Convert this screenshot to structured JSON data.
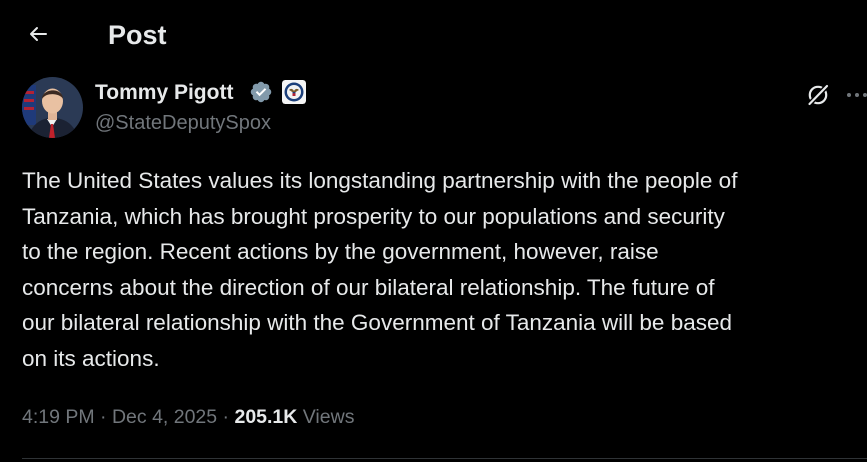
{
  "header": {
    "title": "Post",
    "back_icon": "arrow-left-icon"
  },
  "author": {
    "name": "Tommy Pigott",
    "handle": "@StateDeputySpox",
    "verified_badge_color": "#829aab",
    "affiliate_badge": "us-state-department-seal-icon"
  },
  "actions": {
    "grok_icon": "grok-icon",
    "more_icon": "more-horizontal-icon"
  },
  "post": {
    "text": "The United States values its longstanding partnership with the people of\nTanzania, which has brought prosperity to our populations and security\nto the region. Recent actions by the government, however, raise\nconcerns about the direction of our bilateral relationship. The future of\nour bilateral relationship with the Government of Tanzania will be based\non its actions."
  },
  "meta": {
    "time": "4:19 PM",
    "separator": " · ",
    "date": "Dec 4, 2025",
    "views_count": "205.1K",
    "views_label": " Views"
  },
  "colors": {
    "background": "#000000",
    "primary_text": "#e7e9ea",
    "secondary_text": "#71767b",
    "divider": "#2f3336"
  }
}
